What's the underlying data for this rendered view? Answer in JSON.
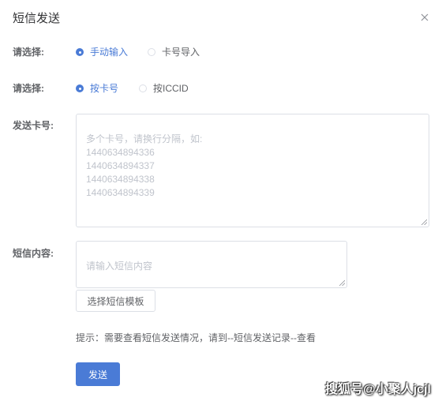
{
  "dialog": {
    "title": "短信发送",
    "close_icon": "close-icon"
  },
  "form": {
    "row1": {
      "label": "请选择:",
      "options": [
        {
          "label": "手动输入",
          "checked": true
        },
        {
          "label": "卡号导入",
          "checked": false
        }
      ]
    },
    "row2": {
      "label": "请选择:",
      "options": [
        {
          "label": "按卡号",
          "checked": true
        },
        {
          "label": "按ICCID",
          "checked": false
        }
      ]
    },
    "card_numbers": {
      "label": "发送卡号:",
      "placeholder": "多个卡号，请换行分隔，如:\n1440634894336\n1440634894337\n1440634894338\n1440634894339"
    },
    "sms_content": {
      "label": "短信内容:",
      "placeholder": "请输入短信内容"
    },
    "template_button": "选择短信模板",
    "tip": "提示：需要查看短信发送情况，请到--短信发送记录--查看",
    "send_button": "发送"
  },
  "watermark": "搜狐号@小聚人jcjl",
  "colors": {
    "accent": "#4a7bd6",
    "border": "#dcdfe6",
    "placeholder": "#c0c4cc",
    "text": "#606266"
  }
}
